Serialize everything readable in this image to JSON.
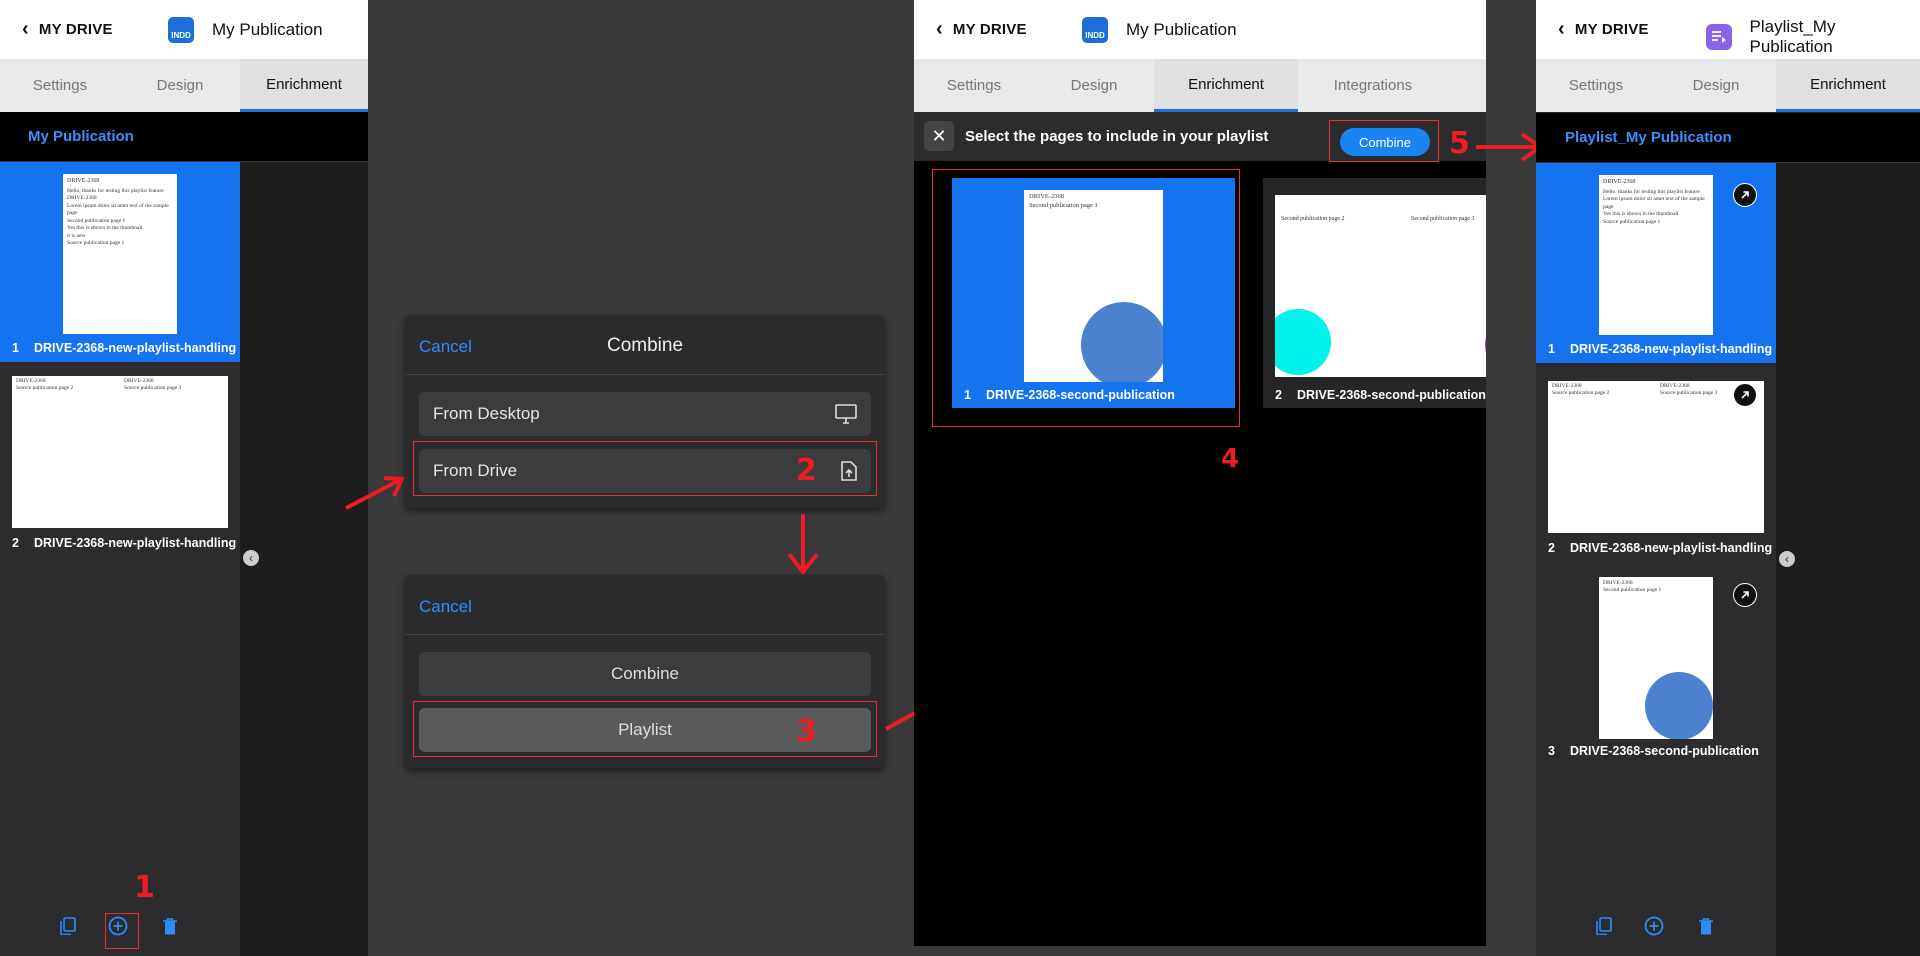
{
  "panel1": {
    "back_label": "MY DRIVE",
    "doc_icon_label": "INDD",
    "doc_title": "My Publication",
    "tabs": [
      "Settings",
      "Design",
      "Enrichment"
    ],
    "publication_title": "My Publication",
    "thumbs": [
      {
        "num": "1",
        "label": "DRIVE-2368-new-playlist-handling",
        "page_title": "DRIVE-2368",
        "page_lines": [
          "Hello, thanks for testing this playlist feature",
          "DRIVE-2368",
          "",
          "Lorem ipsum dolor sit amet text of the sample page",
          "Second publication page 1",
          "Yes this is shown in the thumbnail",
          "it is new",
          "Source publication page 1"
        ]
      },
      {
        "num": "2",
        "label": "DRIVE-2368-new-playlist-handling",
        "page_title_left": "DRIVE-2368",
        "page_title_right": "DRIVE-2368",
        "page_text_left": "Source publication page 2",
        "page_text_right": "Source publication page 3"
      }
    ]
  },
  "annotations": {
    "n1": "1",
    "n2": "2",
    "n3": "3",
    "n4": "4",
    "n5": "5"
  },
  "modal1": {
    "cancel": "Cancel",
    "title": "Combine",
    "options": [
      {
        "label": "From Desktop",
        "icon": "desktop-icon"
      },
      {
        "label": "From Drive",
        "icon": "upload-file-icon"
      }
    ]
  },
  "modal2": {
    "cancel": "Cancel",
    "options": [
      "Combine",
      "Playlist"
    ]
  },
  "panel3": {
    "back_label": "MY DRIVE",
    "doc_icon_label": "INDD",
    "doc_title": "My Publication",
    "tabs": [
      "Settings",
      "Design",
      "Enrichment",
      "Integrations"
    ],
    "select_prompt": "Select the pages to include in your playlist",
    "combine_label": "Combine",
    "cards": [
      {
        "num": "1",
        "label": "DRIVE-2368-second-publication",
        "page_title": "DRIVE-2368",
        "page_text": "Second publication page 1"
      },
      {
        "num": "2",
        "label": "DRIVE-2368-second-publication",
        "page_text_left": "Second publication page 2",
        "page_text_right": "Second publication page 3"
      }
    ]
  },
  "panel4": {
    "back_label": "MY DRIVE",
    "doc_title": "Playlist_My Publication",
    "tabs": [
      "Settings",
      "Design",
      "Enrichment"
    ],
    "publication_title": "Playlist_My Publication",
    "thumbs": [
      {
        "num": "1",
        "label": "DRIVE-2368-new-playlist-handling"
      },
      {
        "num": "2",
        "label": "DRIVE-2368-new-playlist-handling",
        "page_text_left": "Source publication page 2",
        "page_text_right": "Source publication page 3",
        "page_title_left": "DRIVE-2368",
        "page_title_right": "DRIVE-2368"
      },
      {
        "num": "3",
        "label": "DRIVE-2368-second-publication",
        "page_title": "DRIVE-2368",
        "page_text": "Second publication page 1"
      }
    ]
  },
  "colors": {
    "accent": "#1673ef",
    "annotation_red": "#ee1d23",
    "link_blue": "#2f8cf5"
  }
}
